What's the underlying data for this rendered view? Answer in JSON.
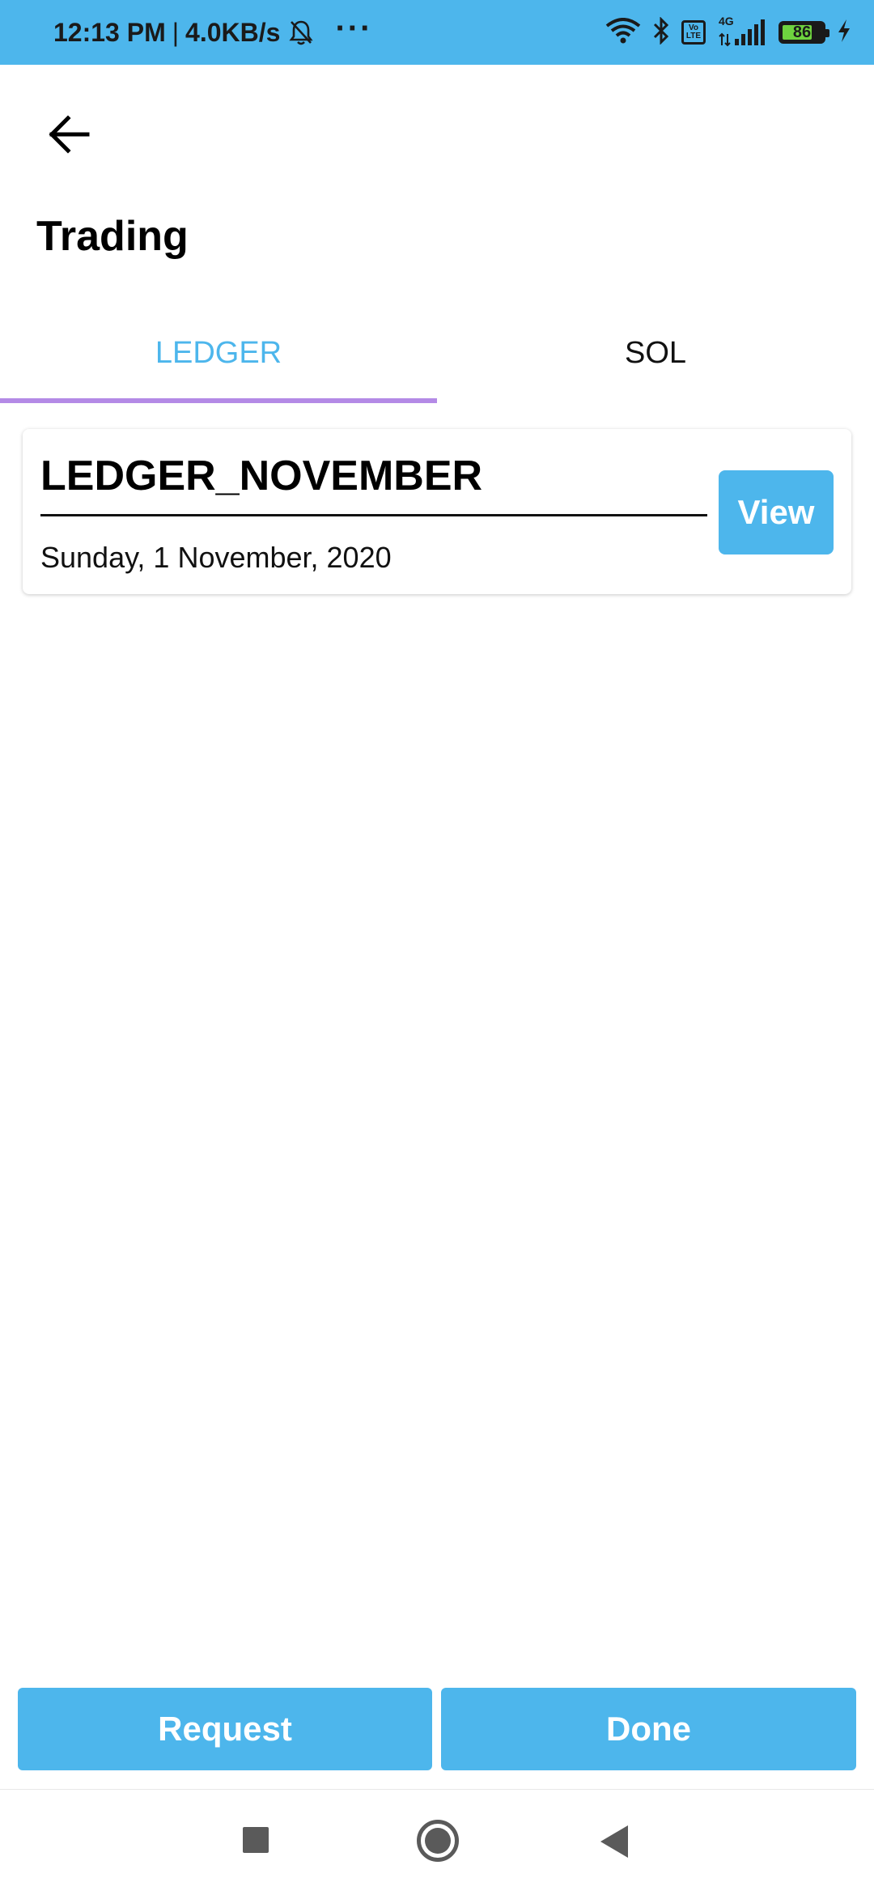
{
  "status_bar": {
    "time": "12:13 PM",
    "separator": "|",
    "net_speed": "4.0KB/s",
    "more": "···",
    "volte_top": "Vo",
    "volte_bottom": "LTE",
    "network": "4G",
    "battery": "86",
    "icons": [
      "mute-bell-icon",
      "wifi-icon",
      "bluetooth-icon",
      "volte-icon",
      "signal-icon",
      "battery-icon",
      "charging-icon"
    ],
    "color": "#4db6ec"
  },
  "header": {
    "back_icon": "arrow-left-icon",
    "title": "Trading"
  },
  "tabs": [
    {
      "label": "LEDGER",
      "selected": true
    },
    {
      "label": "SOL",
      "selected": false
    }
  ],
  "ledger_items": [
    {
      "name": "LEDGER_NOVEMBER",
      "date": "Sunday, 1 November, 2020",
      "action": "View"
    }
  ],
  "footer": {
    "request_label": "Request",
    "done_label": "Done"
  },
  "nav_bar": {
    "icons": [
      "recents-square-icon",
      "home-circle-icon",
      "back-triangle-icon"
    ]
  },
  "colors": {
    "accent": "#4db6ec",
    "tab_indicator": "#b48ae6",
    "text": "#000000"
  }
}
